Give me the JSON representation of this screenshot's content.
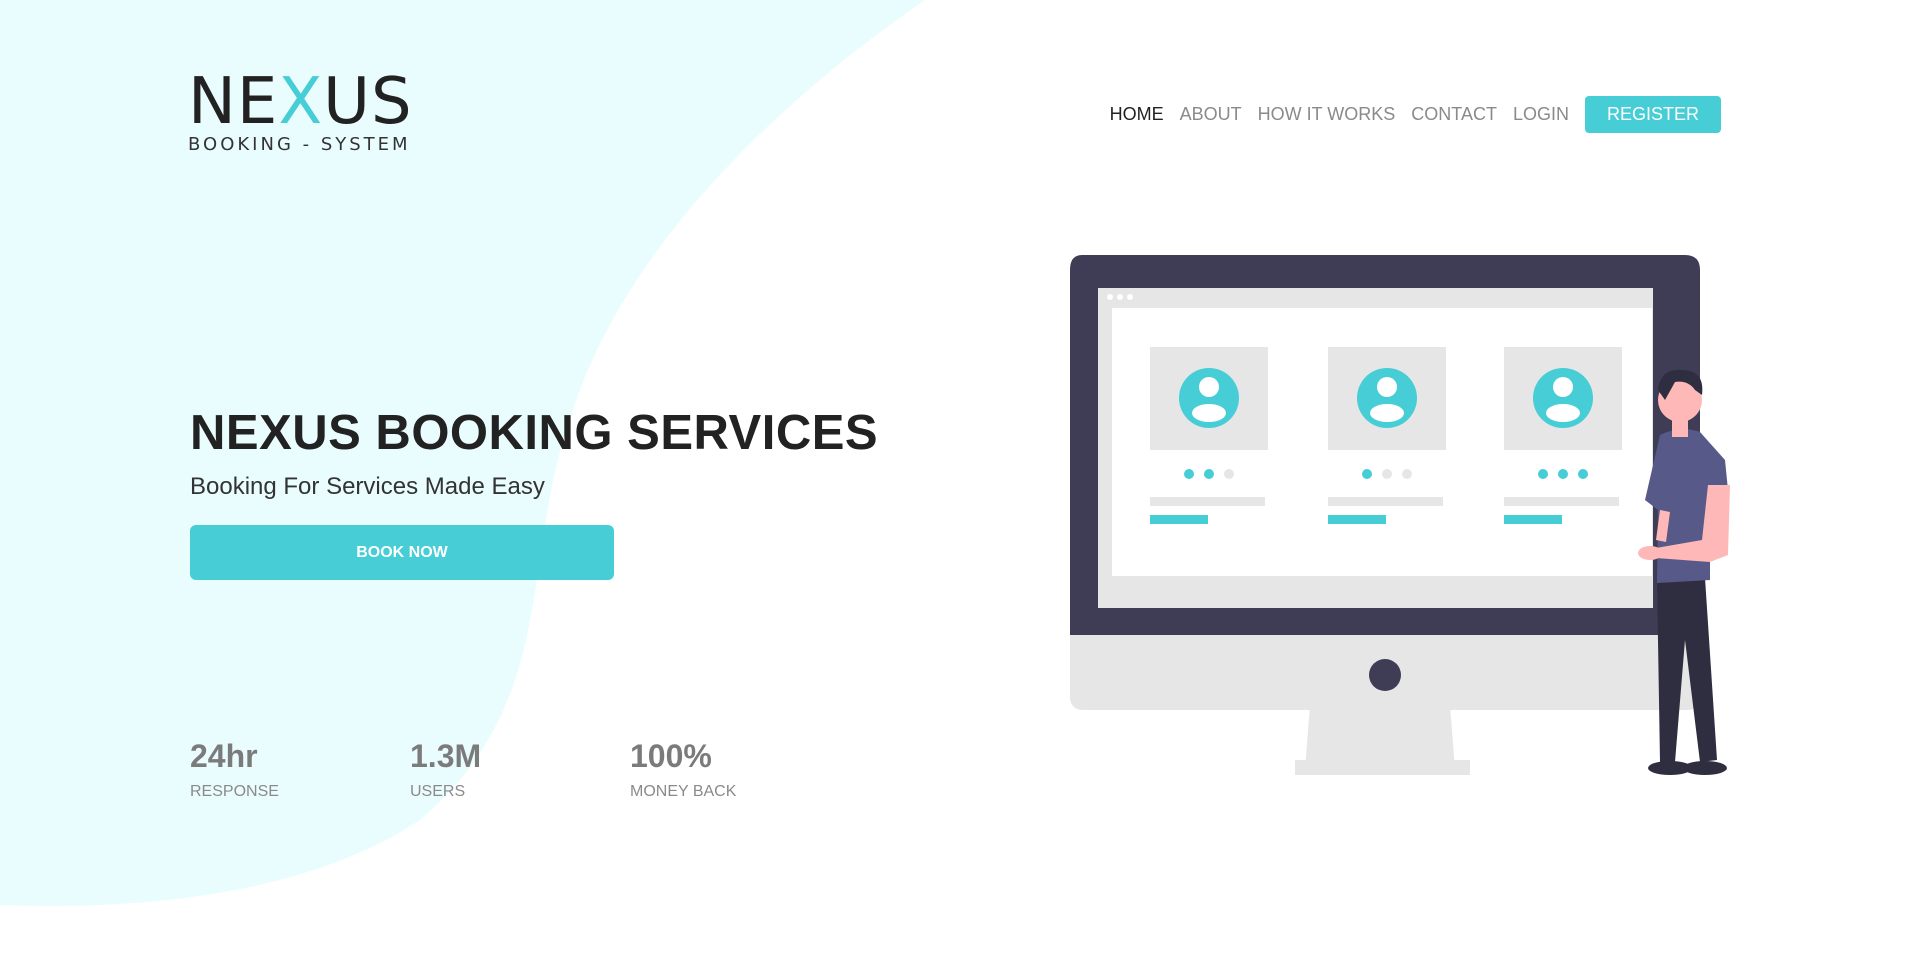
{
  "logo": {
    "word_start": "NE",
    "word_accent": "X",
    "word_end": "US",
    "subtitle": "BOOKING - SYSTEM"
  },
  "nav": {
    "items": [
      {
        "label": "HOME",
        "active": true
      },
      {
        "label": "ABOUT",
        "active": false
      },
      {
        "label": "HOW IT WORKS",
        "active": false
      },
      {
        "label": "CONTACT",
        "active": false
      },
      {
        "label": "LOGIN",
        "active": false
      }
    ],
    "register_label": "REGISTER"
  },
  "hero": {
    "title": "NEXUS BOOKING SERVICES",
    "subtitle": "Booking For Services Made Easy",
    "cta_label": "BOOK NOW"
  },
  "stats": [
    {
      "value": "24hr",
      "label": "RESPONSE"
    },
    {
      "value": "1.3M",
      "label": "USERS"
    },
    {
      "value": "100%",
      "label": "MONEY BACK"
    }
  ],
  "colors": {
    "accent": "#46cdd6",
    "blob": "#eafdfe",
    "monitor_frame": "#3f3d56",
    "monitor_base": "#e6e6e6"
  }
}
